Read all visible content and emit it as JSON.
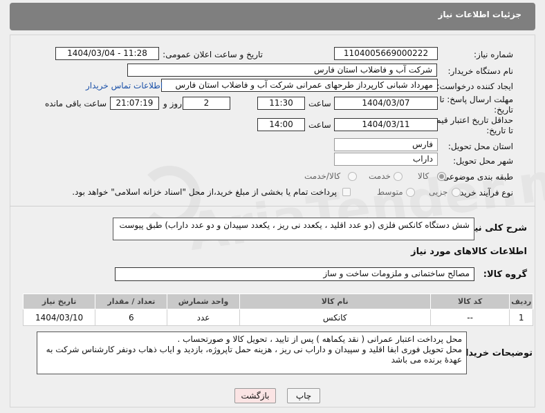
{
  "header": {
    "title": "جزئیات اطلاعات نیاز"
  },
  "fields": {
    "need_number_label": "شماره نیاز:",
    "need_number": "1104005669000222",
    "announce_label": "تاریخ و ساعت اعلان عمومی:",
    "announce_value": "1404/03/04 - 11:28",
    "buyer_org_label": "نام دستگاه خریدار:",
    "buyer_org": "شرکت آب و فاضلاب استان فارس",
    "creator_label": "ایجاد کننده درخواست:",
    "creator": "مهرداد شبانی کارپرداز طرحهای عمرانی  شرکت آب و فاضلاب استان فارس",
    "contact_link": "اطلاعات تماس خریدار",
    "deadline_label_1": "مهلت ارسال پاسخ: تا",
    "deadline_label_2": "تاریخ:",
    "deadline_date": "1404/03/07",
    "hour_label": "ساعت",
    "deadline_time": "11:30",
    "days_value": "2",
    "days_label": "روز و",
    "remaining_time": "21:07:19",
    "remaining_label": "ساعت باقی مانده",
    "min_price_label_1": "حداقل تاریخ اعتبار قیمت:",
    "min_price_label_2": "تا تاریخ:",
    "min_price_date": "1404/03/11",
    "min_price_time": "14:00",
    "province_label": "استان محل تحویل:",
    "province": "فارس",
    "city_label": "شهر محل تحویل:",
    "city": "داراب",
    "category_label": "طبقه بندی موضوعی:",
    "category_options": [
      "کالا",
      "خدمت",
      "کالا/خدمت"
    ],
    "process_label": "نوع فرآیند خرید :",
    "process_options": [
      "جزیی",
      "متوسط"
    ],
    "payment_note": "پرداخت تمام یا بخشی از مبلغ خرید،از محل \"اسناد خزانه اسلامی\" خواهد بود.",
    "description_label": "شرح کلی نیاز:",
    "description": "شش دستگاه کانکس فلزی (دو عدد اقلید ، یکعدد نی ریز ، یکعدد سپیدان و دو عدد داراب) طبق پیوست",
    "goods_info_title": "اطلاعات کالاهای مورد نیاز",
    "goods_group_label": "گروه کالا:",
    "goods_group": "مصالح ساختمانی و ملزومات ساخت و ساز",
    "buyer_notes_label": "توضیحات خریدار:",
    "buyer_notes_1": "محل پرداخت اعتبار عمرانی ( نقد یکماهه ) پس از تایید ، تحویل کالا و صورتحساب .",
    "buyer_notes_2": "محل تحویل فوری ابفا اقلید و سپیدان و داراب نی ریز   ،  هزینه حمل تاپروژه، بازدید و ایاب ذهاب دونفر کارشناس شرکت به عهدهٔ برنده می باشد"
  },
  "table": {
    "headers": [
      "ردیف",
      "کد کالا",
      "نام کالا",
      "واحد شمارش",
      "تعداد / مقدار",
      "تاریخ نیاز"
    ],
    "rows": [
      [
        "1",
        "--",
        "کانکس",
        "عدد",
        "6",
        "1404/03/10"
      ]
    ]
  },
  "buttons": {
    "print": "چاپ",
    "back": "بازگشت"
  },
  "watermark": "AriaTender.neT"
}
